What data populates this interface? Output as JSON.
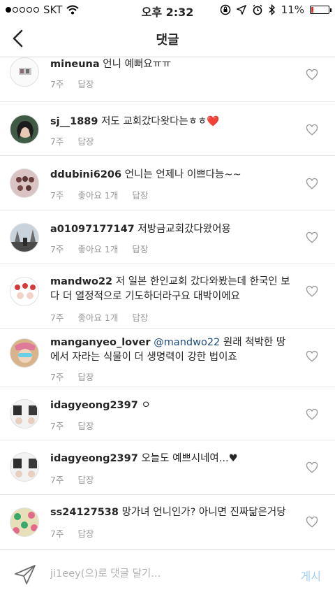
{
  "status_bar": {
    "carrier": "SKT",
    "time": "오후 2:32",
    "battery": "11%",
    "battery_level": 0.11,
    "battery_color": "#e0312a"
  },
  "header": {
    "title": "댓글",
    "back_icon": "chevron-left-icon"
  },
  "comments": [
    {
      "username": "mineuna",
      "text": "언니 예뻐요ㅠㅠ",
      "time": "7주",
      "likes": "",
      "reply": "답장"
    },
    {
      "username": "sj__1889",
      "text": "저도 교회갔다왓다는ㅎㅎ❤️",
      "time": "7주",
      "likes": "",
      "reply": "답장"
    },
    {
      "username": "ddubini6206",
      "text": "언니는 언제나 이쁘다능~~",
      "time": "7주",
      "likes": "좋아요 1개",
      "reply": "답장"
    },
    {
      "username": "a01097177147",
      "text": "저방금교회갔다왔어용",
      "time": "7주",
      "likes": "좋아요 1개",
      "reply": "답장"
    },
    {
      "username": "mandwo22",
      "text": "저 일본 한인교회 갔다와봤는데 한국인 보다 더 열정적으로 기도하더라구요 대박이에요",
      "time": "7주",
      "likes": "좋아요 1개",
      "reply": "답장"
    },
    {
      "username": "manganyeo_lover",
      "mention": "@mandwo22",
      "text": "원래 척박한 땅에서 자라는 식물이 더 생명력이 강한 법이죠",
      "time": "7주",
      "likes": "",
      "reply": "답장"
    },
    {
      "username": "idagyeong2397",
      "text": "ㅇ",
      "time": "7주",
      "likes": "",
      "reply": "답장"
    },
    {
      "username": "idagyeong2397",
      "text": "오늘도 예쁘시네여...♥",
      "time": "7주",
      "likes": "",
      "reply": "답장"
    },
    {
      "username": "ss24127538",
      "text": "망가녀 언니인가? 아니면 진짜닮은거당",
      "time": "7주",
      "likes": "",
      "reply": "답장"
    }
  ],
  "input": {
    "placeholder": "ji1eey(으)로 댓글 달기...",
    "post_label": "게시",
    "send_icon": "paper-plane-icon"
  },
  "colors": {
    "accent": "#9fcdf2",
    "mention": "#1e4a7a",
    "meta": "#999999"
  }
}
